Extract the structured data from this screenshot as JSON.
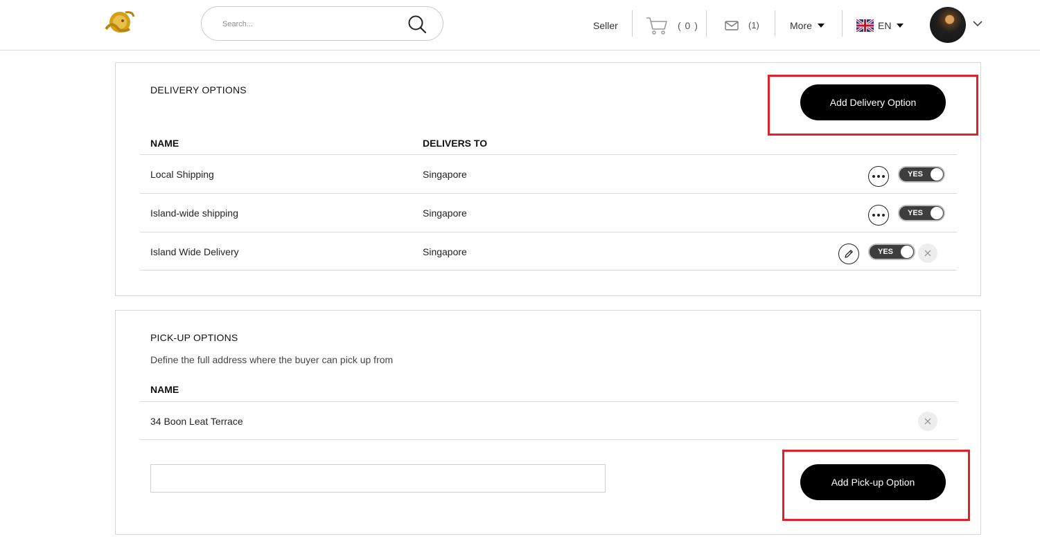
{
  "header": {
    "logo_icon": "golden-lion-logo",
    "search_placeholder": "Search...",
    "seller_label": "Seller",
    "cart_count": "( 0 )",
    "mail_count": "(1)",
    "more_label": "More",
    "language_label": "EN",
    "language_flag": "uk-flag-icon"
  },
  "delivery": {
    "title": "DELIVERY OPTIONS",
    "add_button": "Add Delivery Option",
    "columns": {
      "name": "NAME",
      "delivers_to": "DELIVERS TO"
    },
    "rows": [
      {
        "name": "Local Shipping",
        "delivers_to": "Singapore",
        "toggle": "YES",
        "action": "more"
      },
      {
        "name": "Island-wide shipping",
        "delivers_to": "Singapore",
        "toggle": "YES",
        "action": "more"
      },
      {
        "name": "Island Wide Delivery",
        "delivers_to": "Singapore",
        "toggle": "YES",
        "action": "edit"
      }
    ]
  },
  "pickup": {
    "title": "PICK-UP OPTIONS",
    "description": "Define the full address where the buyer can pick up from",
    "columns": {
      "name": "NAME"
    },
    "rows": [
      {
        "name": "34 Boon Leat Terrace"
      }
    ],
    "input_value": "",
    "add_button": "Add Pick-up Option"
  },
  "colors": {
    "accent": "#000000",
    "highlight": "#e2202a",
    "toggle_bg": "#3d3d3d",
    "logo_gold": "#d4a017"
  }
}
